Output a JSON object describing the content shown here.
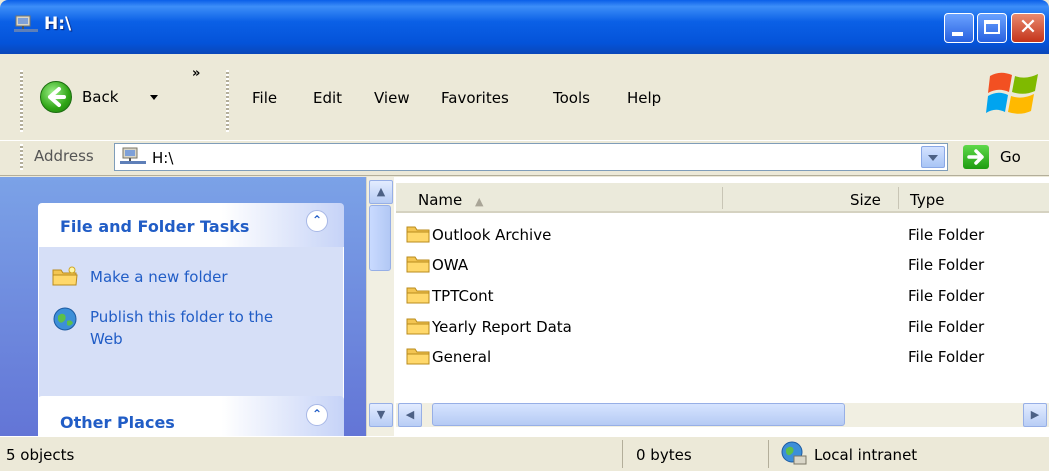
{
  "window": {
    "title": "H:\\"
  },
  "toolbar": {
    "back_label": "Back",
    "more_label": "»"
  },
  "menu": [
    {
      "label": "File"
    },
    {
      "label": "Edit"
    },
    {
      "label": "View"
    },
    {
      "label": "Favorites"
    },
    {
      "label": "Tools"
    },
    {
      "label": "Help"
    }
  ],
  "address": {
    "label": "Address",
    "value": "H:\\",
    "go_label": "Go"
  },
  "tasks": {
    "file_folder_title": "File and Folder Tasks",
    "items": [
      {
        "label": "Make a new folder"
      },
      {
        "label": "Publish this folder to the Web"
      }
    ],
    "other_places_title": "Other Places"
  },
  "files": {
    "columns": {
      "name": "Name",
      "size": "Size",
      "type": "Type"
    },
    "rows": [
      {
        "name": "Outlook Archive",
        "type": "File Folder"
      },
      {
        "name": "OWA",
        "type": "File Folder"
      },
      {
        "name": "TPTCont",
        "type": "File Folder"
      },
      {
        "name": "Yearly Report Data",
        "type": "File Folder"
      },
      {
        "name": "General",
        "type": "File Folder"
      }
    ]
  },
  "status": {
    "objects": "5 objects",
    "size": "0 bytes",
    "zone": "Local intranet"
  },
  "colors": {
    "titlebar": "#0a5fe9",
    "task_link": "#215dc6",
    "task_pane": "#7ba2e7"
  }
}
